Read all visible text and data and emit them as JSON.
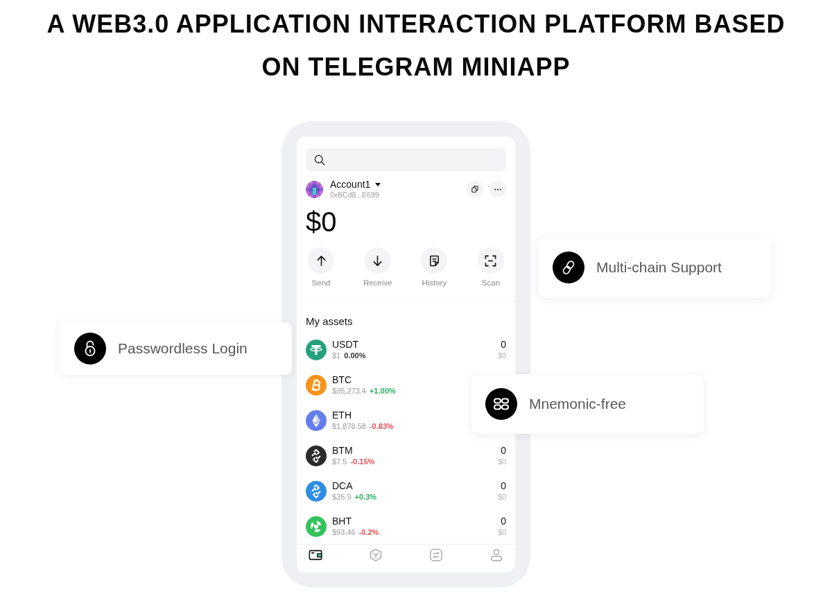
{
  "title": "A WEB3.0 APPLICATION INTERACTION PLATFORM BASED ON TELEGRAM MINIAPP",
  "wallet": {
    "account": {
      "name": "Account1",
      "address": "0xBCd8...E699"
    },
    "balance": "$0",
    "actions": [
      {
        "label": "Send"
      },
      {
        "label": "Receive"
      },
      {
        "label": "History"
      },
      {
        "label": "Scan"
      }
    ],
    "assets": {
      "heading": "My assets",
      "items": [
        {
          "symbol": "USDT",
          "color": "#26a17b",
          "price": "$1",
          "change": {
            "text": "0.00%",
            "color": "#333333"
          },
          "amount": "0",
          "value": "$0"
        },
        {
          "symbol": "BTC",
          "color": "#f7931a",
          "price": "$35,273.4",
          "change": {
            "text": "+1.00%",
            "color": "#27b15d"
          }
        },
        {
          "symbol": "ETH",
          "color": "#627eea",
          "price": "$1,878.58",
          "change": {
            "text": "-0.83%",
            "color": "#e5535a"
          }
        },
        {
          "symbol": "BTM",
          "color": "#2b2b2b",
          "price": "$7.5",
          "change": {
            "text": "-0.15%",
            "color": "#e5535a"
          },
          "amount": "0",
          "value": "$0"
        },
        {
          "symbol": "DCA",
          "color": "#2f8de4",
          "price": "$35.9",
          "change": {
            "text": "+0.3%",
            "color": "#27b15d"
          },
          "amount": "0",
          "value": "$0"
        },
        {
          "symbol": "BHT",
          "color": "#34c25c",
          "price": "$93.46",
          "change": {
            "text": "-0.2%",
            "color": "#e5535a"
          },
          "amount": "0",
          "value": "$0"
        }
      ]
    },
    "bottom_nav": [
      {
        "selected": true
      },
      {
        "selected": false
      },
      {
        "selected": false
      },
      {
        "selected": false
      }
    ]
  },
  "features": [
    {
      "label": "Multi-chain Support"
    },
    {
      "label": "Passwordless Login"
    },
    {
      "label": "Mnemonic-free"
    }
  ]
}
